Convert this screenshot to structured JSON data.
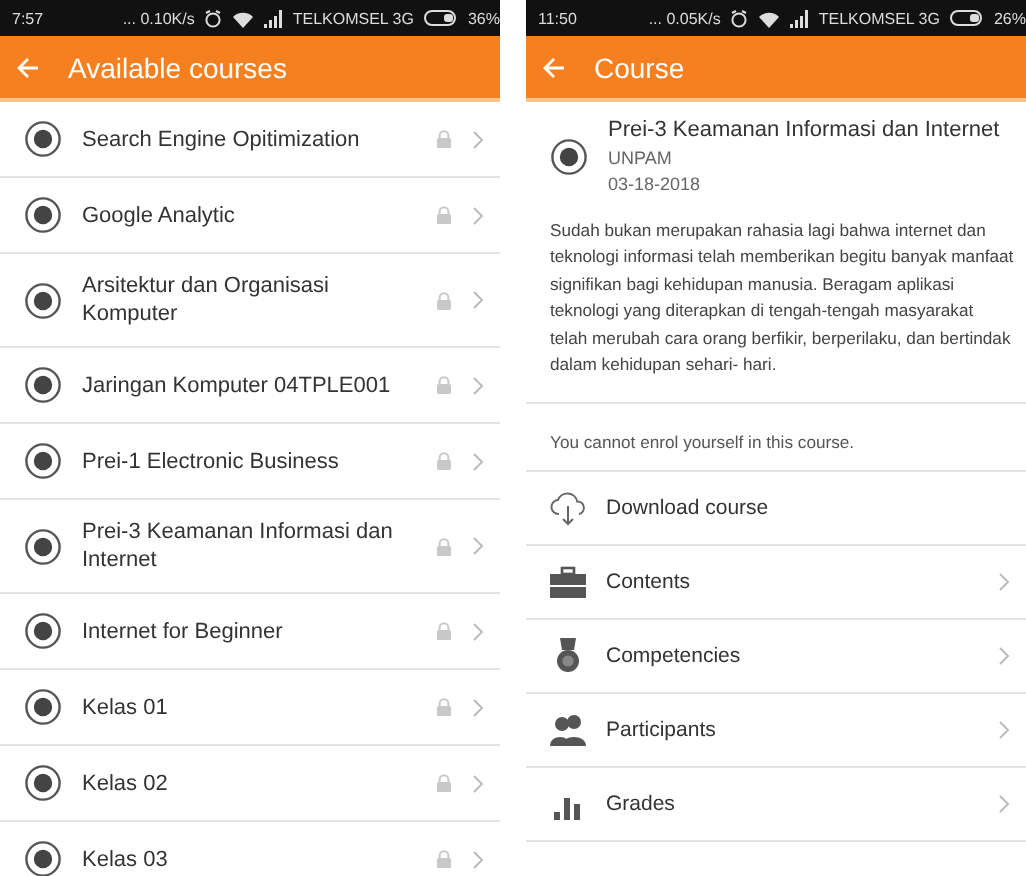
{
  "screens": [
    {
      "kind": "course_list",
      "status_bar": {
        "time": "7:57",
        "speed": "... 0.10K/s",
        "carrier": "TELKOMSEL 3G",
        "battery": "36%"
      },
      "app_bar": {
        "title": "Available courses"
      },
      "courses": [
        {
          "name": "Search Engine Opitimization",
          "locked": true
        },
        {
          "name": "Google Analytic",
          "locked": true
        },
        {
          "name": "Arsitektur dan Organisasi Komputer",
          "locked": true
        },
        {
          "name": "Jaringan Komputer 04TPLE001",
          "locked": true
        },
        {
          "name": "Prei-1 Electronic Business",
          "locked": true
        },
        {
          "name": "Prei-3 Keamanan Informasi dan Internet",
          "locked": true
        },
        {
          "name": "Internet for Beginner",
          "locked": true
        },
        {
          "name": "Kelas 01",
          "locked": true
        },
        {
          "name": "Kelas 02",
          "locked": true
        },
        {
          "name": "Kelas 03",
          "locked": true
        }
      ]
    },
    {
      "kind": "course_detail",
      "status_bar": {
        "time": "11:50",
        "speed": "... 0.05K/s",
        "carrier": "TELKOMSEL 3G",
        "battery": "26%"
      },
      "app_bar": {
        "title": "Course"
      },
      "course": {
        "name": "Prei-3 Keamanan Informasi dan Internet",
        "category": "UNPAM",
        "date": "03-18-2018"
      },
      "description": "Sudah bukan merupakan rahasia lagi bahwa internet dan teknologi informasi telah memberikan begitu banyak manfaat signifikan bagi kehidupan manusia. Beragam aplikasi teknologi yang diterapkan di tengah-tengah masyarakat telah merubah cara orang berfikir, berperilaku, dan bertindak dalam kehidupan sehari- hari.",
      "notice": "You cannot enrol yourself in this course.",
      "menu": [
        {
          "label": "Download course",
          "chevron": false
        },
        {
          "label": "Contents",
          "chevron": true
        },
        {
          "label": "Competencies",
          "chevron": true
        },
        {
          "label": "Participants",
          "chevron": true
        },
        {
          "label": "Grades",
          "chevron": true
        }
      ]
    }
  ]
}
